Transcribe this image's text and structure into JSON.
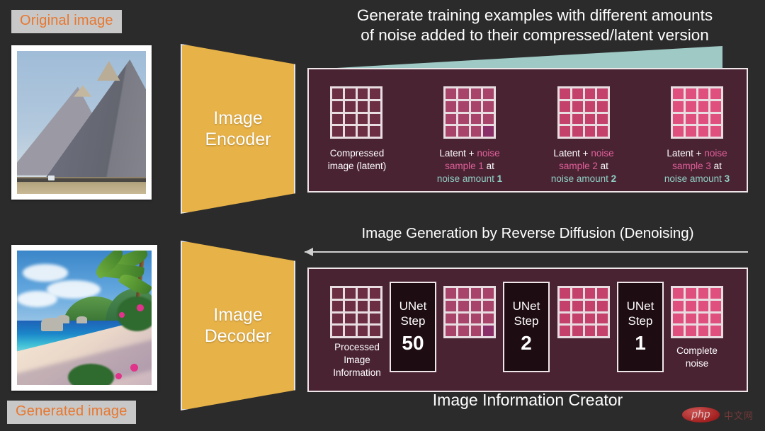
{
  "theme": {
    "background": "#2b2b2b",
    "panel_bg": "#4a2333",
    "panel_border": "#efe6ea",
    "trapezoid": "#e7b248",
    "accent_orange": "#e8772e",
    "tag_bg": "#c8c8c8",
    "noise_wedge": "#9ec9c5",
    "noise_text": "#e0609a",
    "amount_text": "#8fd0c4",
    "unet_bg": "#1e0c13"
  },
  "labels": {
    "original_image": "Original image",
    "generated_image": "Generated image"
  },
  "encoder": {
    "line1": "Image",
    "line2": "Encoder"
  },
  "decoder": {
    "line1": "Image",
    "line2": "Decoder"
  },
  "top": {
    "heading_line1": "Generate training examples with different amounts",
    "heading_line2": "of noise added to their compressed/latent version",
    "items": [
      {
        "cell_color": "#6b2e42",
        "highlight_color": null,
        "caption_line1": "Compressed",
        "caption_line2": "image (latent)",
        "caption_line3": "",
        "style": "plain"
      },
      {
        "cell_color": "#a8436a",
        "highlight_color": "#8b2f68",
        "prefix": "Latent + ",
        "noise_word": "noise",
        "sample_text": "sample 1",
        "at_word": " at",
        "amount_text": "noise amount ",
        "amount_value": "1",
        "style": "noisy"
      },
      {
        "cell_color": "#c4416c",
        "highlight_color": null,
        "prefix": "Latent + ",
        "noise_word": "noise",
        "sample_text": "sample 2",
        "at_word": " at",
        "amount_text": "noise amount ",
        "amount_value": "2",
        "style": "noisy"
      },
      {
        "cell_color": "#e0507f",
        "highlight_color": null,
        "prefix": "Latent + ",
        "noise_word": "noise",
        "sample_text": "sample 3",
        "at_word": " at",
        "amount_text": "noise amount ",
        "amount_value": "3",
        "style": "noisy"
      }
    ]
  },
  "middle": {
    "label": "Image Generation by Reverse Diffusion (Denoising)",
    "arrow_direction": "left"
  },
  "bottom": {
    "caption": "Image Information Creator",
    "grids": [
      {
        "cell_color": "#6b2e42",
        "highlight_color": null,
        "caption_line1": "Processed",
        "caption_line2": "Image",
        "caption_line3": "Information"
      },
      {
        "cell_color": "#a8436a",
        "highlight_color": "#8b2f68",
        "caption_line1": "",
        "caption_line2": "",
        "caption_line3": ""
      },
      {
        "cell_color": "#c4416c",
        "highlight_color": null,
        "caption_line1": "",
        "caption_line2": "",
        "caption_line3": ""
      },
      {
        "cell_color": "#e0507f",
        "highlight_color": null,
        "caption_line1": "Complete",
        "caption_line2": "noise",
        "caption_line3": ""
      }
    ],
    "unets": [
      {
        "title_line1": "UNet",
        "title_line2": "Step",
        "number": "50"
      },
      {
        "title_line1": "UNet",
        "title_line2": "Step",
        "number": "2"
      },
      {
        "title_line1": "UNet",
        "title_line2": "Step",
        "number": "1"
      }
    ]
  },
  "watermark": {
    "badge": "php",
    "suffix": "中文网"
  }
}
